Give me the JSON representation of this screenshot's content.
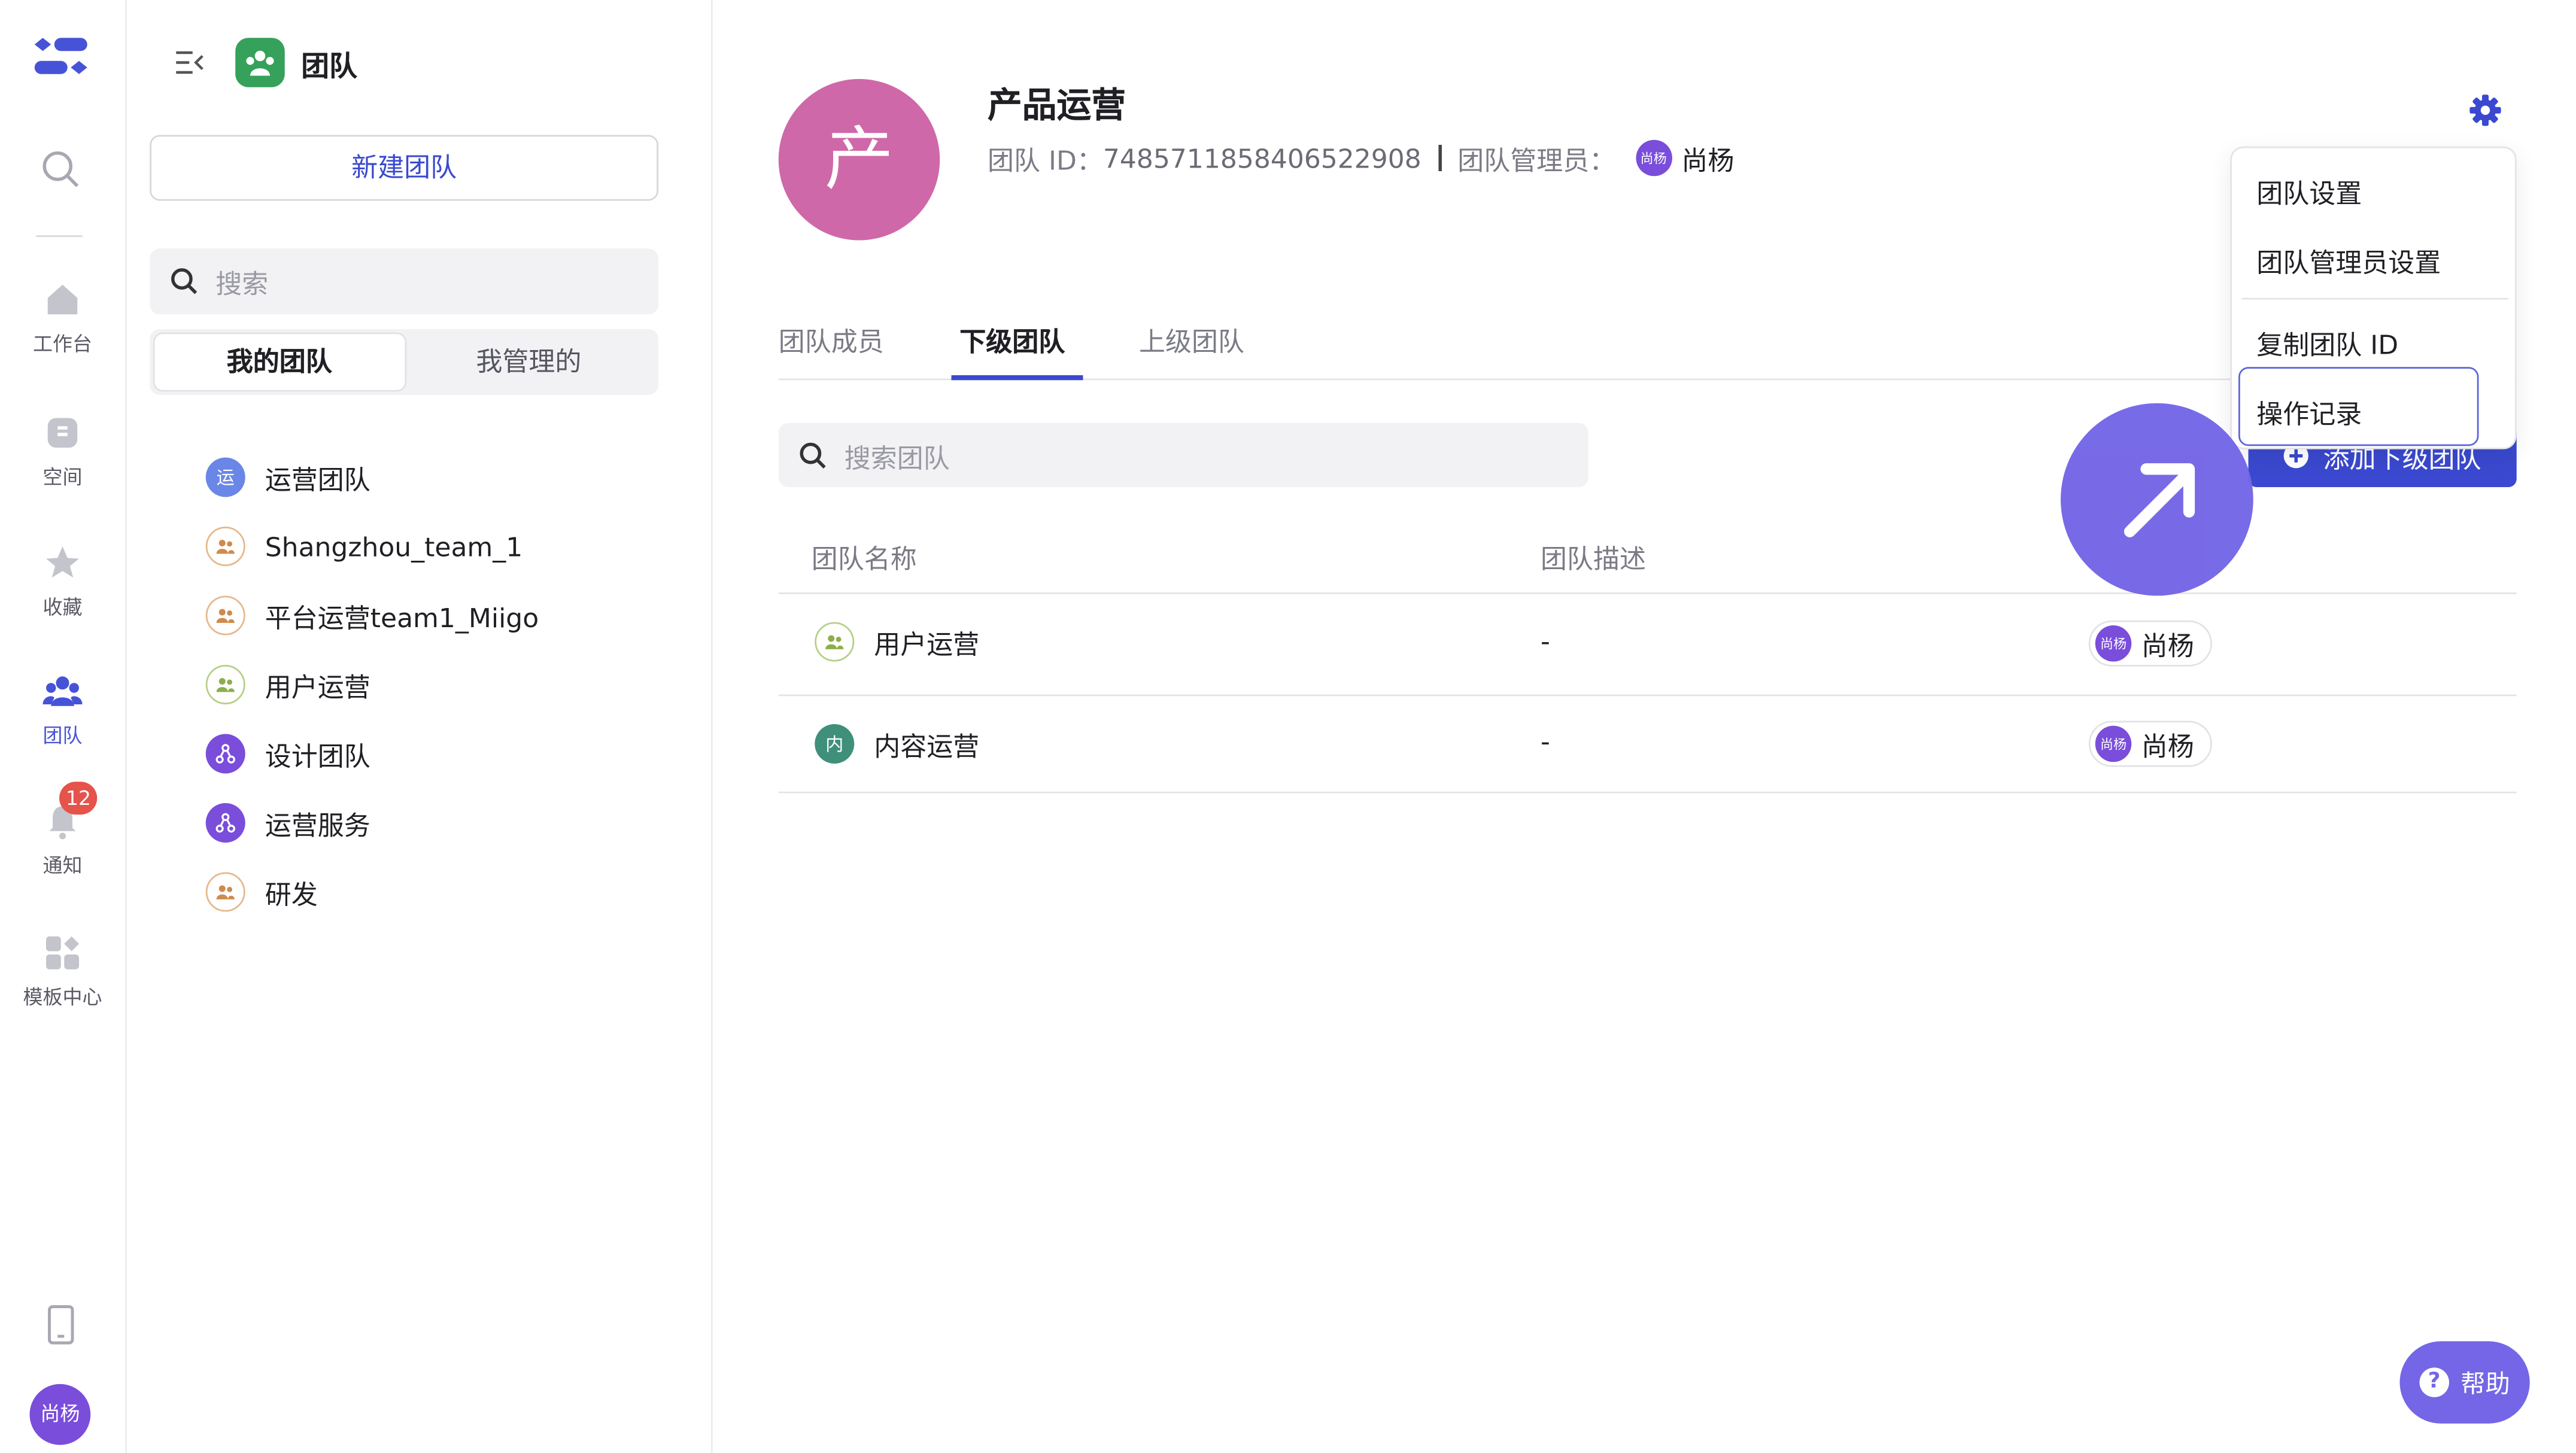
{
  "rail": {
    "items": [
      {
        "label": "工作台",
        "icon": "home-icon"
      },
      {
        "label": "空间",
        "icon": "space-icon"
      },
      {
        "label": "收藏",
        "icon": "star-icon"
      },
      {
        "label": "团队",
        "icon": "team-icon",
        "active": true
      },
      {
        "label": "通知",
        "icon": "bell-icon",
        "badge": "12"
      },
      {
        "label": "模板中心",
        "icon": "template-icon"
      }
    ],
    "user_avatar": "尚杨"
  },
  "panel": {
    "title": "团队",
    "new_team_label": "新建团队",
    "search_placeholder": "搜索",
    "segments": [
      "我的团队",
      "我管理的"
    ],
    "teams": [
      {
        "name": "运营团队",
        "avatar": "运"
      },
      {
        "name": "Shangzhou_team_1"
      },
      {
        "name": "平台运营team1_Miigo"
      },
      {
        "name": "用户运营"
      },
      {
        "name": "设计团队"
      },
      {
        "name": "运营服务"
      },
      {
        "name": "研发"
      }
    ]
  },
  "team": {
    "avatar": "产",
    "name": "产品运营",
    "id_label": "团队 ID：",
    "id": "7485711858406522908",
    "admin_label": "团队管理员：",
    "admin_avatar": "尚杨",
    "admin_name": "尚杨"
  },
  "tabs": [
    "团队成员",
    "下级团队",
    "上级团队"
  ],
  "sub": {
    "search_placeholder": "搜索团队",
    "add_label": "添加下级团队",
    "columns": [
      "团队名称",
      "团队描述"
    ],
    "rows": [
      {
        "name": "用户运营",
        "desc": "-",
        "admin_avatar": "尚杨",
        "admin": "尚杨"
      },
      {
        "name": "内容运营",
        "avatar": "内",
        "desc": "-",
        "admin_avatar": "尚杨",
        "admin": "尚杨"
      }
    ]
  },
  "menu": {
    "items": [
      "团队设置",
      "团队管理员设置",
      "复制团队 ID",
      "操作记录"
    ]
  },
  "help_label": "帮助",
  "colors": {
    "accent": "#3a49cf",
    "purple": "#7466e6",
    "team_avatar": "#cf68a9",
    "badge": "#e5534b"
  }
}
